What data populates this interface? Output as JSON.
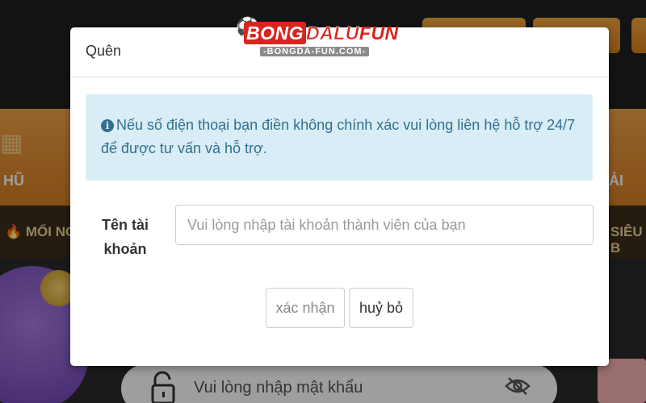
{
  "background": {
    "nav_left_label": "HŨ",
    "nav_right_label": "ẢI",
    "ticker_left": "MỐI NGA",
    "ticker_right": "SIÊU B",
    "password_placeholder": "Vui lòng nhập mật khẩu"
  },
  "watermark": {
    "brand_part1": "BONG",
    "brand_part2": "DALU",
    "brand_part3": "FUN",
    "domain": "-BONGDA-FUN.COM-"
  },
  "modal": {
    "title": "Quên",
    "info_icon": "info-circle-icon",
    "info_text": "Nếu số điện thoại bạn điền không chính xác vui lòng liên hệ hỗ trợ 24/7 để được tư vấn và hỗ trợ.",
    "username_label": "Tên tài khoản",
    "username_value": "",
    "username_placeholder": "Vui lòng nhập tài khoản thành viên của bạn",
    "confirm_button": "xác nhận",
    "cancel_button": "huỷ bỏ"
  },
  "colors": {
    "info_bg": "#d9edf7",
    "info_text": "#31708f",
    "accent_orange": "#e8952f",
    "brand_red": "#d7261e"
  }
}
